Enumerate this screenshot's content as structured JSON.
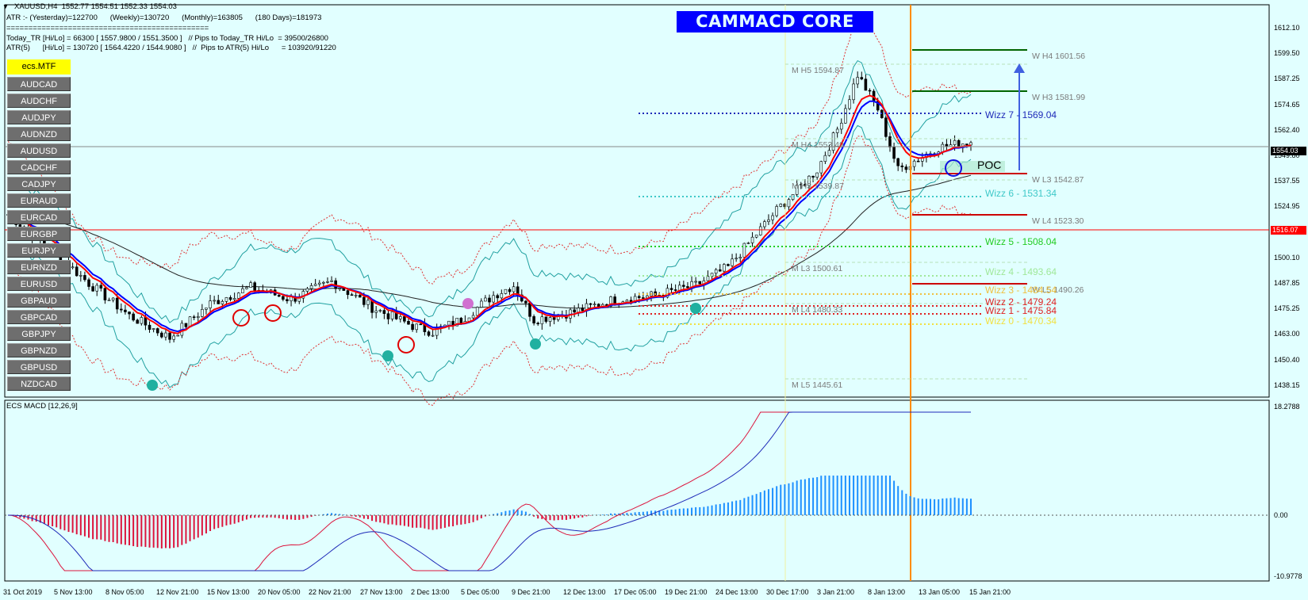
{
  "header": {
    "symbol_line": "XAUUSD,H4  1552.77 1554.51 1552.33 1554.03",
    "atr_line": "ATR :- (Yesterday)=122700      (Weekly)=130720      (Monthly)=163805      (180 Days)=181973",
    "separator": "==============================================",
    "today_tr_line": "Today_TR [Hi/Lo] = 66300 [ 1557.9800 / 1551.3500 ]   // Pips to Today_TR Hi/Lo  = 39500/26800",
    "atr5_line": "ATR(5)      [Hi/Lo] = 130720 [ 1564.4220 / 1544.9080 ]   //  Pips to ATR(5) Hi/Lo      = 103920/91220"
  },
  "banner": "CAMMACD CORE",
  "mtf_button": "ecs.MTF",
  "symbols": [
    "AUDCAD",
    "AUDCHF",
    "AUDJPY",
    "AUDNZD",
    "AUDUSD",
    "CADCHF",
    "CADJPY",
    "EURAUD",
    "EURCAD",
    "EURGBP",
    "EURJPY",
    "EURNZD",
    "EURUSD",
    "GBPAUD",
    "GBPCAD",
    "GBPJPY",
    "GBPNZD",
    "GBPUSD",
    "NZDCAD"
  ],
  "level_labels": {
    "w_h4": "W  H4 1601.56",
    "w_h3": "W  H3 1581.99",
    "w_l3": "W  L3 1542.87",
    "w_l4": "W  L4 1523.30",
    "w_l5": "W  L5 1490.26",
    "m_h5": "M  H5 1594.87",
    "m_h4": "M  H4 1553.49",
    "m_h3": "M  H3 1539.87",
    "m_l3": "M  L3 1500.61",
    "m_l4": "M  L4 1480.33",
    "m_l5": "M  L5 1445.61"
  },
  "wizz": {
    "w7": "Wizz 7 - 1569.04",
    "w6": "Wizz 6 - 1531.34",
    "w5": "Wizz 5 - 1508.04",
    "w4": "Wizz 4 - 1493.64",
    "w3": "Wizz 3 - 1484.54",
    "w2": "Wizz 2 - 1479.24",
    "w1": "Wizz 1 - 1475.84",
    "w0": "Wizz 0 - 1470.34"
  },
  "poc": "POC",
  "price_axis": [
    "1612.10",
    "1599.50",
    "1587.25",
    "1574.65",
    "1562.40",
    "1549.80",
    "1537.55",
    "1524.95",
    "1512.70",
    "1500.10",
    "1487.85",
    "1475.25",
    "1463.00",
    "1450.40",
    "1438.15"
  ],
  "price_tags": {
    "current": "1554.03",
    "red_line": "1516.07"
  },
  "macd": {
    "title": "ECS MACD [12,26,9]",
    "axis_top": "18.2788",
    "axis_zero": "0.00",
    "axis_bottom": "-10.9778"
  },
  "dates": [
    "31 Oct 2019",
    "5 Nov 13:00",
    "8 Nov 05:00",
    "12 Nov 21:00",
    "15 Nov 13:00",
    "20 Nov 05:00",
    "22 Nov 21:00",
    "27 Nov 13:00",
    "2 Dec 13:00",
    "5 Dec 05:00",
    "9 Dec 21:00",
    "12 Dec 13:00",
    "17 Dec 05:00",
    "19 Dec 21:00",
    "24 Dec 13:00",
    "30 Dec 17:00",
    "3 Jan 21:00",
    "8 Jan 13:00",
    "13 Jan 05:00",
    "15 Jan 21:00"
  ],
  "colors": {
    "background": "#e1ffff",
    "up_candle": "#000000",
    "ema_fast": "#ff0000",
    "ema_slow": "#0000ff",
    "bollinger": "#20a0a0",
    "vline": "#ff8c00",
    "macd_pos": "#1e90ff",
    "macd_neg": "#dc143c"
  }
}
